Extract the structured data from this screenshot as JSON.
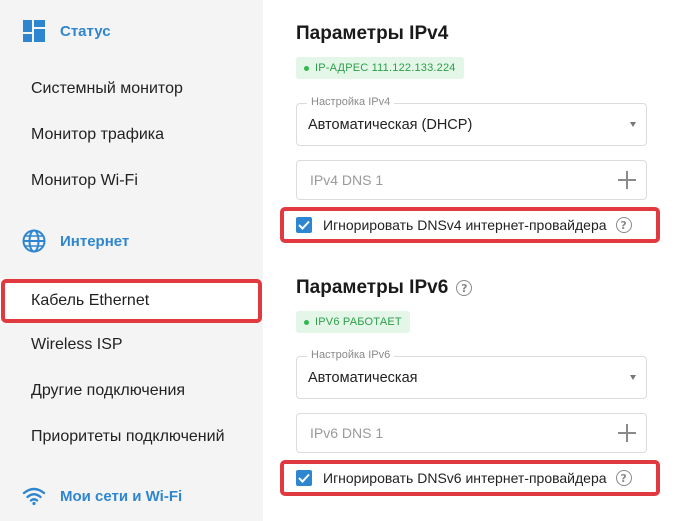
{
  "sidebar": {
    "status": {
      "label": "Статус",
      "icon": "dashboard-icon"
    },
    "status_items": [
      {
        "label": "Системный монитор"
      },
      {
        "label": "Монитор трафика"
      },
      {
        "label": "Монитор Wi-Fi"
      }
    ],
    "internet": {
      "label": "Интернет",
      "icon": "globe-icon"
    },
    "internet_items": [
      {
        "label": "Кабель Ethernet",
        "active": true
      },
      {
        "label": "Wireless ISP"
      },
      {
        "label": "Другие подключения"
      },
      {
        "label": "Приоритеты подключений"
      }
    ],
    "networks": {
      "label": "Мои сети и Wi-Fi",
      "icon": "wifi-icon"
    }
  },
  "main": {
    "ipv4": {
      "title": "Параметры IPv4",
      "badge": "IP-АДРЕС 111.122.133.224",
      "setting_legend": "Настройка IPv4",
      "setting_value": "Автоматическая (DHCP)",
      "dns_placeholder": "IPv4 DNS 1",
      "ignore_label": "Игнорировать DNSv4 интернет-провайдера",
      "ignore_checked": true
    },
    "ipv6": {
      "title": "Параметры IPv6",
      "badge": "IPV6 РАБОТАЕТ",
      "setting_legend": "Настройка IPv6",
      "setting_value": "Автоматическая",
      "dns_placeholder": "IPv6 DNS 1",
      "ignore_label": "Игнорировать DNSv6 интернет-провайдера",
      "ignore_checked": true
    }
  },
  "colors": {
    "accent": "#2f86d0",
    "highlight": "#e0393f",
    "ok": "#2fb84f"
  }
}
